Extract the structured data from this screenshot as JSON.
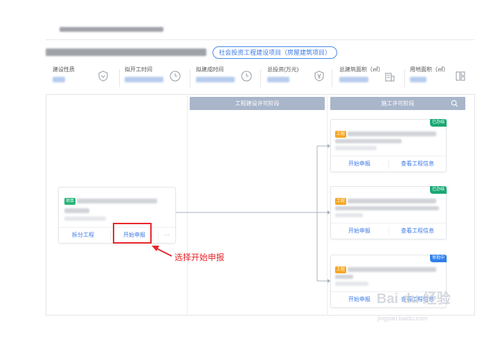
{
  "project": {
    "type_tag": "社会投资工程建设项目（房屋建筑项目）"
  },
  "info": [
    {
      "label": "建设性质",
      "icon": "shield-icon"
    },
    {
      "label": "拟开工时间",
      "icon": "clock-icon"
    },
    {
      "label": "拟建成时间",
      "icon": "clock-icon"
    },
    {
      "label": "总投资(万元)",
      "icon": "yen-icon"
    },
    {
      "label": "总建筑面积（㎡）",
      "icon": "building-icon"
    },
    {
      "label": "用地面积（㎡）",
      "icon": "floorplan-icon"
    }
  ],
  "stages": [
    {
      "title": "工程建设许可阶段"
    },
    {
      "title": "施工许可阶段"
    }
  ],
  "project_card": {
    "tag": "项目",
    "actions": {
      "split": "拆分工程",
      "start": "开始申报",
      "more": "···"
    }
  },
  "works_cards": [
    {
      "tag": "工程",
      "status": "已办结",
      "actions": {
        "start": "开始申报",
        "view": "查看工程信息"
      }
    },
    {
      "tag": "工程",
      "status": "已办结",
      "actions": {
        "start": "开始申报",
        "view": "查看工程信息"
      }
    },
    {
      "tag": "工程",
      "status": "审批中",
      "actions": {
        "start": "开始申报",
        "view": "查看工程信息"
      }
    }
  ],
  "annotation": {
    "text": "选择开始申报"
  },
  "watermark": {
    "logo": "Bai du 经验",
    "url": "jingyan.baidu.com"
  },
  "colors": {
    "accent": "#3b78e7",
    "stage_header": "#a9b5c9",
    "tag_green": "#27b47a",
    "tag_orange": "#f5a623",
    "status_green": "#19a974",
    "status_blue": "#2f80ed",
    "annotation_red": "#e8242a"
  }
}
